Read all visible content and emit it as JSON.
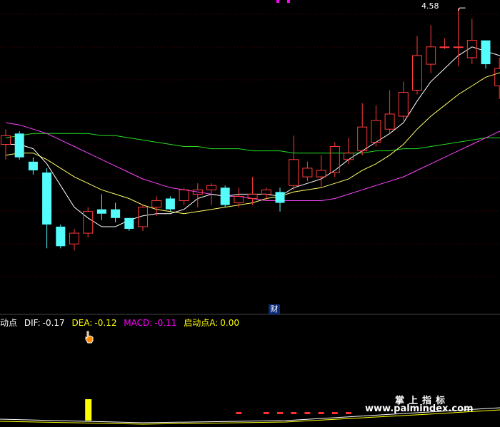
{
  "indicator_name": "启动点",
  "legend": {
    "name_prefix": "动点",
    "dif": {
      "label": "DIF:",
      "value": "-0.17",
      "color": "#ffffff"
    },
    "dea": {
      "label": "DEA:",
      "value": "-0.12",
      "color": "#ffff00"
    },
    "macd": {
      "label": "MACD:",
      "value": "-0.11",
      "color": "#ff00ff"
    },
    "qdd": {
      "label": "启动点A:",
      "value": "0.00",
      "color": "#ffff00"
    }
  },
  "peak_label": "4.58",
  "cai_badge": "财",
  "watermark": {
    "line1": "掌上指标",
    "line2": "www.palmindex.com"
  },
  "colors": {
    "up": "#ff3b3b",
    "down": "#54fcfc",
    "ma5": "#ffffff",
    "ma10": "#ffff66",
    "ma20": "#ff44ff",
    "ma60": "#22dd22",
    "grid": "#5a0000"
  },
  "chart_data": {
    "type": "candlestick",
    "ylim": [
      3.3,
      4.6
    ],
    "peak": 4.58,
    "candles": [
      {
        "o": 3.95,
        "h": 4.02,
        "l": 3.88,
        "c": 3.99
      },
      {
        "o": 4.0,
        "h": 4.01,
        "l": 3.88,
        "c": 3.89
      },
      {
        "o": 3.87,
        "h": 3.89,
        "l": 3.81,
        "c": 3.83
      },
      {
        "o": 3.82,
        "h": 3.84,
        "l": 3.47,
        "c": 3.58
      },
      {
        "o": 3.57,
        "h": 3.58,
        "l": 3.47,
        "c": 3.48
      },
      {
        "o": 3.49,
        "h": 3.56,
        "l": 3.46,
        "c": 3.54
      },
      {
        "o": 3.54,
        "h": 3.66,
        "l": 3.52,
        "c": 3.64
      },
      {
        "o": 3.65,
        "h": 3.72,
        "l": 3.6,
        "c": 3.63
      },
      {
        "o": 3.65,
        "h": 3.68,
        "l": 3.59,
        "c": 3.61
      },
      {
        "o": 3.61,
        "h": 3.61,
        "l": 3.55,
        "c": 3.56
      },
      {
        "o": 3.57,
        "h": 3.67,
        "l": 3.55,
        "c": 3.66
      },
      {
        "o": 3.66,
        "h": 3.71,
        "l": 3.62,
        "c": 3.69
      },
      {
        "o": 3.7,
        "h": 3.71,
        "l": 3.64,
        "c": 3.65
      },
      {
        "o": 3.69,
        "h": 3.75,
        "l": 3.67,
        "c": 3.74
      },
      {
        "o": 3.72,
        "h": 3.77,
        "l": 3.66,
        "c": 3.74
      },
      {
        "o": 3.74,
        "h": 3.77,
        "l": 3.67,
        "c": 3.76
      },
      {
        "o": 3.75,
        "h": 3.76,
        "l": 3.66,
        "c": 3.67
      },
      {
        "o": 3.68,
        "h": 3.75,
        "l": 3.66,
        "c": 3.71
      },
      {
        "o": 3.7,
        "h": 3.8,
        "l": 3.67,
        "c": 3.72
      },
      {
        "o": 3.72,
        "h": 3.75,
        "l": 3.69,
        "c": 3.74
      },
      {
        "o": 3.73,
        "h": 3.75,
        "l": 3.64,
        "c": 3.68
      },
      {
        "o": 3.76,
        "h": 3.99,
        "l": 3.74,
        "c": 3.88
      },
      {
        "o": 3.8,
        "h": 3.87,
        "l": 3.78,
        "c": 3.84
      },
      {
        "o": 3.8,
        "h": 3.9,
        "l": 3.75,
        "c": 3.83
      },
      {
        "o": 3.82,
        "h": 3.96,
        "l": 3.8,
        "c": 3.94
      },
      {
        "o": 3.88,
        "h": 3.98,
        "l": 3.86,
        "c": 3.91
      },
      {
        "o": 3.92,
        "h": 4.14,
        "l": 3.9,
        "c": 4.03
      },
      {
        "o": 3.96,
        "h": 4.13,
        "l": 3.94,
        "c": 4.06
      },
      {
        "o": 4.02,
        "h": 4.2,
        "l": 4.0,
        "c": 4.09
      },
      {
        "o": 4.08,
        "h": 4.24,
        "l": 4.06,
        "c": 4.19
      },
      {
        "o": 4.2,
        "h": 4.45,
        "l": 4.18,
        "c": 4.36
      },
      {
        "o": 4.32,
        "h": 4.5,
        "l": 4.28,
        "c": 4.4
      },
      {
        "o": 4.4,
        "h": 4.44,
        "l": 4.39,
        "c": 4.4
      },
      {
        "o": 4.4,
        "h": 4.58,
        "l": 4.31,
        "c": 4.4
      },
      {
        "o": 4.35,
        "h": 4.53,
        "l": 4.32,
        "c": 4.43
      },
      {
        "o": 4.43,
        "h": 4.43,
        "l": 4.3,
        "c": 4.32
      },
      {
        "o": 4.22,
        "h": 4.35,
        "l": 4.16,
        "c": 4.3
      },
      {
        "o": 4.34,
        "h": 4.48,
        "l": 4.3,
        "c": 4.38
      },
      {
        "o": 4.32,
        "h": 4.35,
        "l": 3.94,
        "c": 4.0
      },
      {
        "o": 4.0,
        "h": 4.09,
        "l": 3.87,
        "c": 4.03
      }
    ],
    "ma5": [
      3.95,
      3.95,
      3.93,
      3.86,
      3.76,
      3.66,
      3.61,
      3.57,
      3.57,
      3.6,
      3.62,
      3.63,
      3.63,
      3.65,
      3.7,
      3.72,
      3.71,
      3.72,
      3.72,
      3.72,
      3.71,
      3.75,
      3.77,
      3.79,
      3.83,
      3.88,
      3.92,
      3.96,
      4.0,
      4.05,
      4.15,
      4.24,
      4.3,
      4.36,
      4.4,
      4.38,
      4.36,
      4.35,
      4.31,
      4.2
    ],
    "ma10": [
      3.9,
      3.91,
      3.91,
      3.88,
      3.84,
      3.8,
      3.77,
      3.74,
      3.72,
      3.7,
      3.67,
      3.65,
      3.64,
      3.63,
      3.64,
      3.65,
      3.66,
      3.67,
      3.68,
      3.7,
      3.71,
      3.73,
      3.74,
      3.75,
      3.77,
      3.79,
      3.83,
      3.86,
      3.9,
      3.95,
      4.02,
      4.08,
      4.13,
      4.18,
      4.22,
      4.26,
      4.28,
      4.3,
      4.28,
      4.27
    ],
    "ma20": [
      4.05,
      4.04,
      4.02,
      4.0,
      3.97,
      3.94,
      3.91,
      3.88,
      3.85,
      3.82,
      3.79,
      3.77,
      3.75,
      3.74,
      3.73,
      3.72,
      3.71,
      3.71,
      3.7,
      3.69,
      3.69,
      3.69,
      3.69,
      3.69,
      3.7,
      3.72,
      3.74,
      3.76,
      3.78,
      3.8,
      3.83,
      3.86,
      3.89,
      3.92,
      3.95,
      3.98,
      4.01,
      4.04,
      4.06,
      4.08
    ],
    "ma60": [
      3.98,
      3.99,
      4.0,
      4.0,
      4.0,
      4.0,
      4.0,
      3.99,
      3.99,
      3.98,
      3.97,
      3.96,
      3.95,
      3.94,
      3.94,
      3.93,
      3.93,
      3.93,
      3.92,
      3.92,
      3.92,
      3.91,
      3.91,
      3.91,
      3.91,
      3.91,
      3.91,
      3.92,
      3.92,
      3.93,
      3.93,
      3.94,
      3.95,
      3.96,
      3.97,
      3.98,
      3.98,
      3.99,
      4.0,
      4.01
    ],
    "qdd_signal_index": 6,
    "macd_hist_red_indices": [
      17,
      19,
      20,
      21,
      22,
      23,
      24,
      25
    ]
  }
}
